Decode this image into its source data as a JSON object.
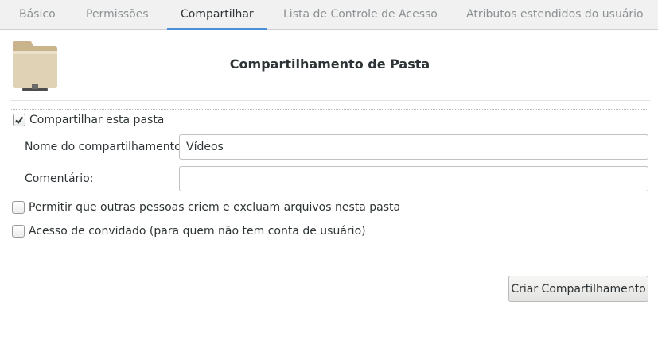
{
  "tabs": [
    {
      "label": "Básico",
      "active": false
    },
    {
      "label": "Permissões",
      "active": false
    },
    {
      "label": "Compartilhar",
      "active": true
    },
    {
      "label": "Lista de Controle de Acesso",
      "active": false
    },
    {
      "label": "Atributos estendidos do usuário",
      "active": false
    }
  ],
  "header": {
    "icon": "folder-icon",
    "title": "Compartilhamento de Pasta"
  },
  "share_folder": {
    "label": "Compartilhar esta pasta",
    "checked": true
  },
  "share_name": {
    "label": "Nome do compartilhamento:",
    "value": "Vídeos"
  },
  "comment": {
    "label": "Comentário:",
    "value": ""
  },
  "allow_others": {
    "label": "Permitir que outras pessoas criem e excluam arquivos nesta pasta",
    "checked": false
  },
  "guest_access": {
    "label": "Acesso de convidado (para quem não tem conta de usuário)",
    "checked": false
  },
  "create_button": {
    "label": "Criar Compartilhamento"
  },
  "colors": {
    "accent": "#4a90d9",
    "folder": "#e0d2b4"
  }
}
